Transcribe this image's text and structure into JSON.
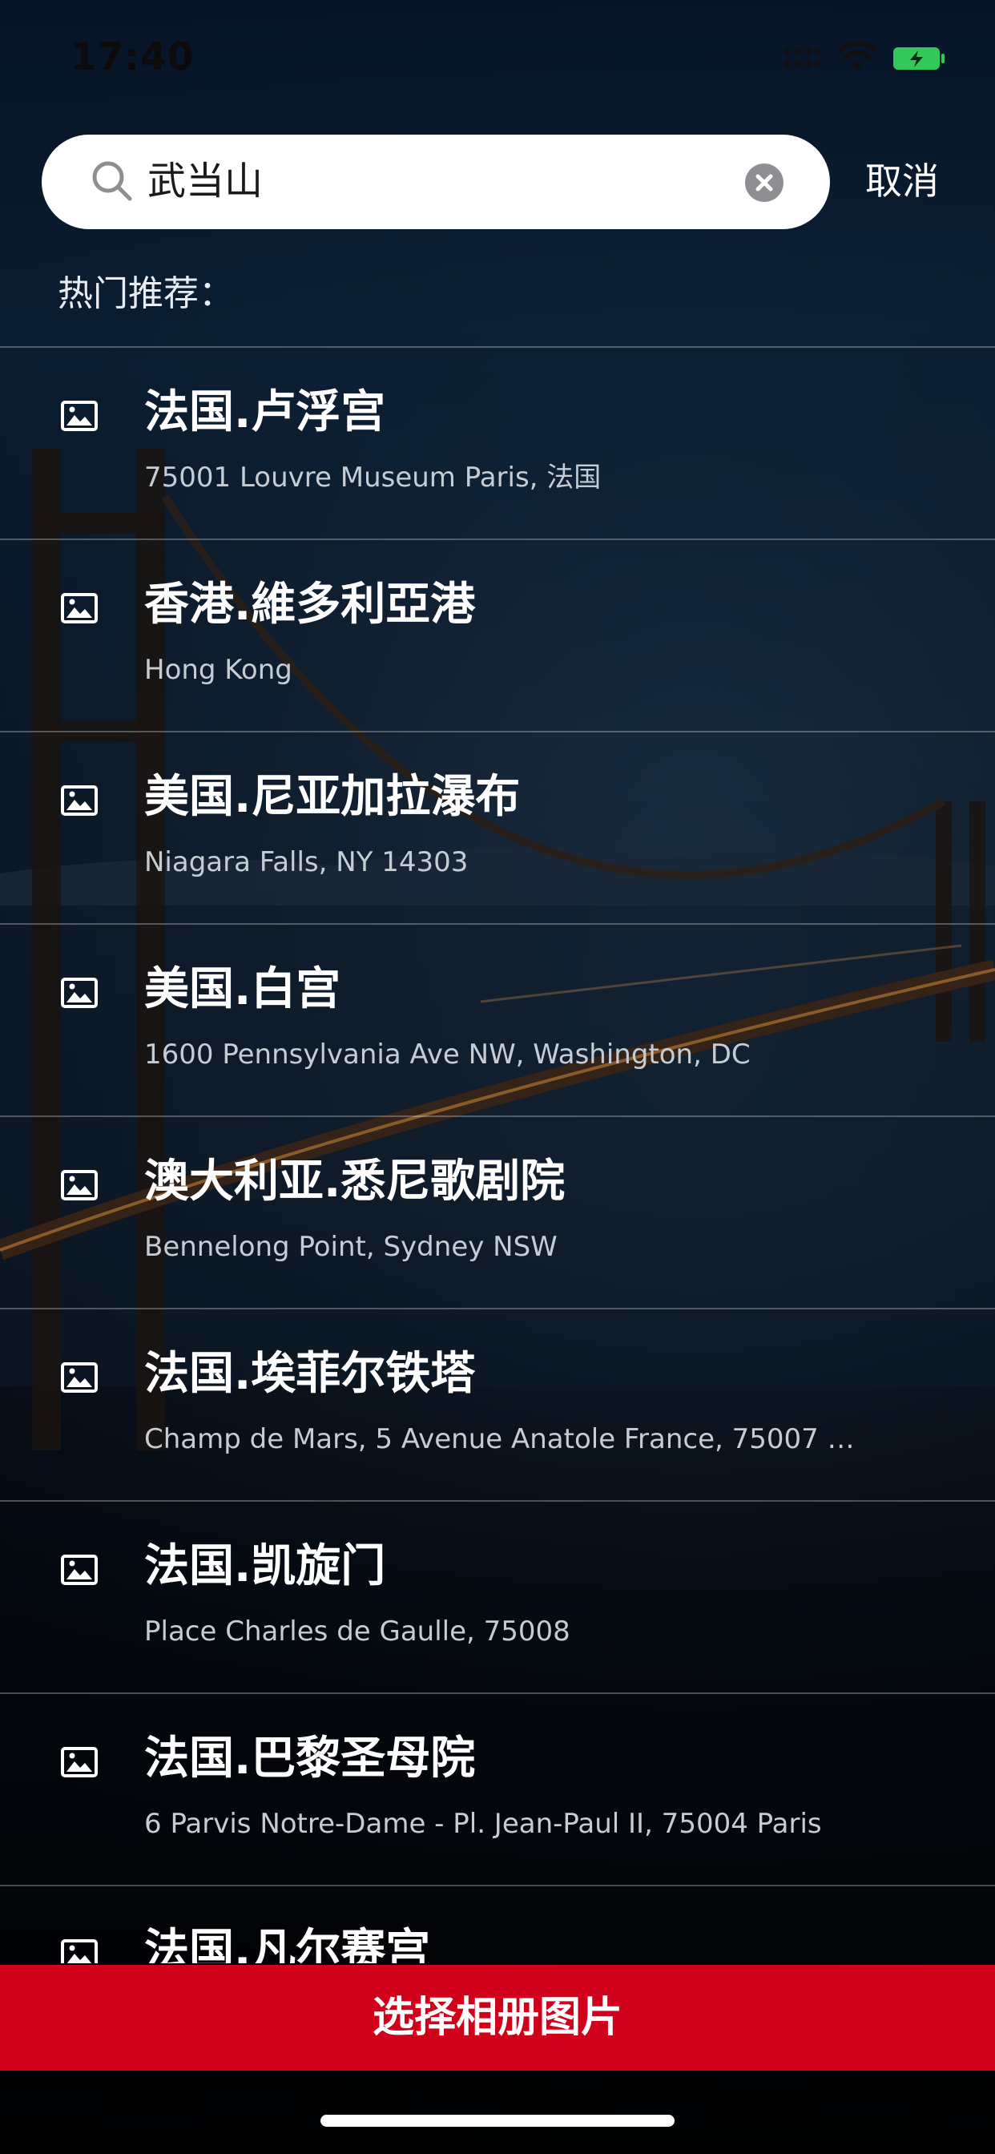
{
  "status_bar": {
    "time": "17:40",
    "battery_color": "#34c759"
  },
  "search": {
    "query": "武当山",
    "cancel_label": "取消"
  },
  "section_label": "热门推荐：",
  "places": [
    {
      "title": "法国.卢浮宫",
      "subtitle": "75001 Louvre Museum Paris, 法国"
    },
    {
      "title": "香港.維多利亞港",
      "subtitle": "Hong Kong"
    },
    {
      "title": "美国.尼亚加拉瀑布",
      "subtitle": "Niagara Falls, NY 14303"
    },
    {
      "title": "美国.白宫",
      "subtitle": "1600 Pennsylvania Ave NW, Washington, DC"
    },
    {
      "title": "澳大利亚.悉尼歌剧院",
      "subtitle": "Bennelong Point, Sydney NSW"
    },
    {
      "title": "法国.埃菲尔铁塔",
      "subtitle": "Champ de Mars, 5 Avenue Anatole France, 75007 P..."
    },
    {
      "title": "法国.凯旋门",
      "subtitle": "Place Charles de Gaulle, 75008"
    },
    {
      "title": "法国.巴黎圣母院",
      "subtitle": "6 Parvis Notre-Dame - Pl. Jean-Paul II, 75004 Paris"
    },
    {
      "title": "法国.凡尔赛宫",
      "subtitle": ""
    }
  ],
  "place_icon": "image-icon",
  "album_button": {
    "label": "选择相册图片",
    "color": "#d0021b"
  }
}
